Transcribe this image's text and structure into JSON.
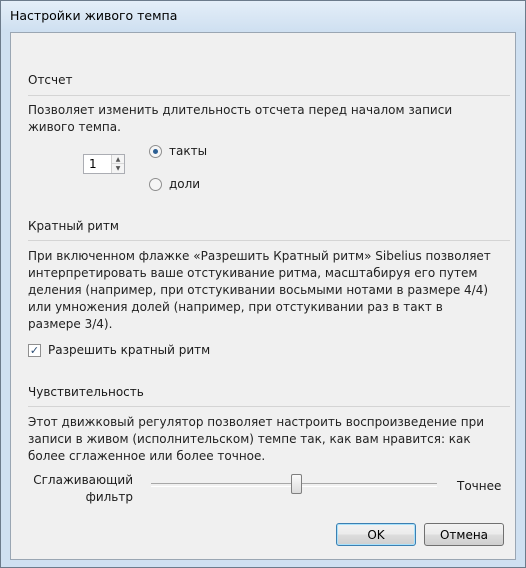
{
  "window": {
    "title": "Настройки живого темпа"
  },
  "countoff": {
    "title": "Отсчет",
    "description": "Позволяет изменить длительность отсчета перед началом записи живого темпа.",
    "value": "1",
    "options": [
      {
        "label": "такты",
        "checked": true
      },
      {
        "label": "доли",
        "checked": false
      }
    ]
  },
  "rhythm": {
    "title": "Кратный ритм",
    "description": "При включенном флажке «Разрешить Кратный ритм» Sibelius позволяет интерпретировать ваше отстукивание ритма, масштабируя его путем деления (например, при отстукивании восьмыми нотами в размере 4/4) или умножения долей (например, при отстукивании раз в такт в размере 3/4).",
    "checkbox_label": "Разрешить кратный ритм",
    "checked": true
  },
  "sensitivity": {
    "title": "Чувствительность",
    "description": "Этот движковый регулятор позволяет настроить воспроизведение при записи в живом (исполнительском) темпе так, как вам нравится: как более сглаженное или более точное.",
    "left_label": "Сглаживающий фильтр",
    "right_label": "Точнее",
    "level_percent": 47
  },
  "buttons": {
    "ok": "OK",
    "cancel": "Отмена"
  }
}
